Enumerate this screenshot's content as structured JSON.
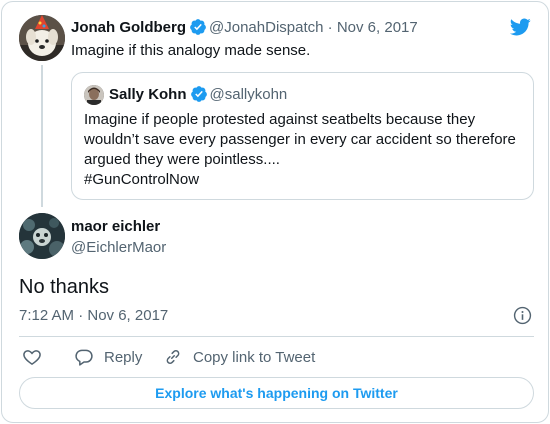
{
  "parent_tweet": {
    "author_name": "Jonah Goldberg",
    "author_handle": "@JonahDispatch",
    "date": "Nov 6, 2017",
    "text": "Imagine if this analogy made sense.",
    "quoted": {
      "author_name": "Sally Kohn",
      "author_handle": "@sallykohn",
      "text_lines": [
        "Imagine if people protested against seatbelts because they",
        "wouldn’t save every passenger in every car accident so therefore",
        "argued they were pointless....",
        "#GunControlNow"
      ]
    }
  },
  "tweet": {
    "author_name": "maor eichler",
    "author_handle": "@EichlerMaor",
    "text": "No thanks",
    "timestamp": "7:12 AM · Nov 6, 2017"
  },
  "actions": {
    "like_label": "",
    "reply_label": "Reply",
    "copy_label": "Copy link to Tweet"
  },
  "explore_label": "Explore what's happening on Twitter",
  "separator": " · ",
  "colors": {
    "brand_blue": "#1d9bf0",
    "muted_text": "#536471",
    "border": "#cfd9de",
    "text": "#0f1419"
  },
  "icons": [
    "twitter-bird-icon",
    "verified-badge-icon",
    "info-icon",
    "heart-icon",
    "reply-icon",
    "link-icon"
  ]
}
